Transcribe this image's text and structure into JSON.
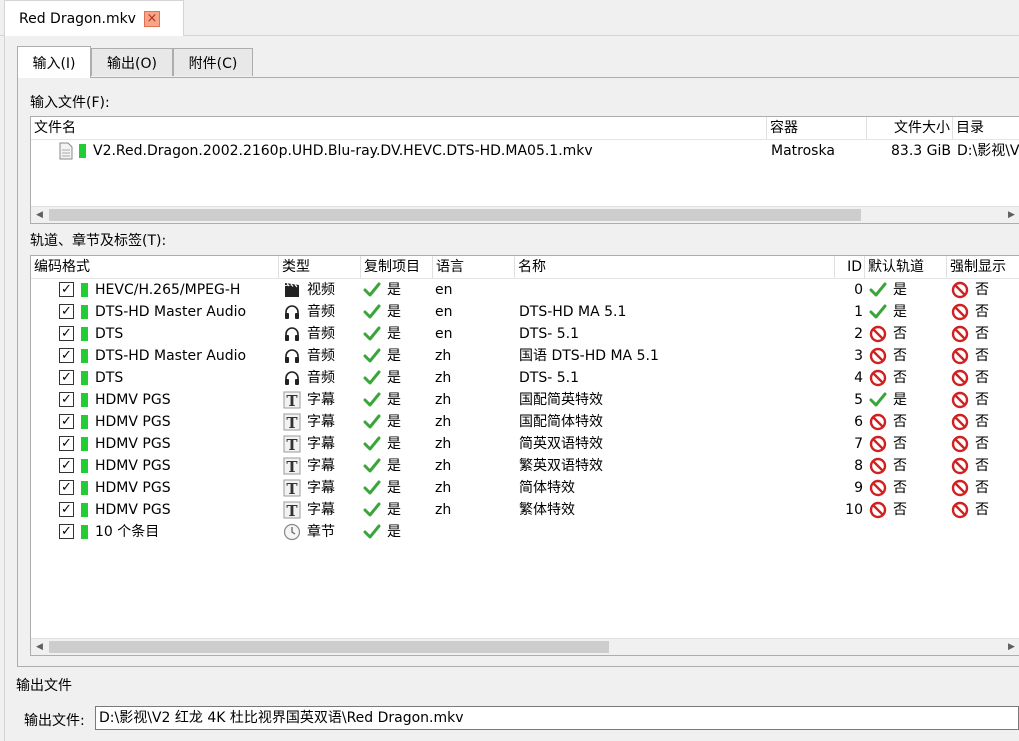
{
  "document_tab": {
    "label": "Red Dragon.mkv",
    "close_glyph": "×"
  },
  "subtabs": [
    {
      "label": "输入(I)"
    },
    {
      "label": "输出(O)"
    },
    {
      "label": "附件(C)"
    }
  ],
  "input_files": {
    "label": "输入文件(F):",
    "columns": [
      "文件名",
      "容器",
      "文件大小",
      "目录"
    ],
    "rows": [
      {
        "name": "V2.Red.Dragon.2002.2160p.UHD.Blu-ray.DV.HEVC.DTS-HD.MA05.1.mkv",
        "container": "Matroska",
        "size": "83.3 GiB",
        "dir": "D:\\影视\\V"
      }
    ]
  },
  "tracks": {
    "label": "轨道、章节及标签(T):",
    "columns": [
      "编码格式",
      "类型",
      "复制项目",
      "语言",
      "名称",
      "ID",
      "默认轨道",
      "强制显示"
    ],
    "rows": [
      {
        "codec": "HEVC/H.265/MPEG-H",
        "icon": "video-icon",
        "type": "视频",
        "copy": "是",
        "lang": "en",
        "name": "",
        "id": "0",
        "default_yes": true,
        "default": "是",
        "forced": "否"
      },
      {
        "codec": "DTS-HD Master Audio",
        "icon": "headphones-icon",
        "type": "音频",
        "copy": "是",
        "lang": "en",
        "name": "DTS-HD MA 5.1",
        "id": "1",
        "default_yes": true,
        "default": "是",
        "forced": "否"
      },
      {
        "codec": "DTS",
        "icon": "headphones-icon",
        "type": "音频",
        "copy": "是",
        "lang": "en",
        "name": "DTS- 5.1",
        "id": "2",
        "default_yes": false,
        "default": "否",
        "forced": "否"
      },
      {
        "codec": "DTS-HD Master Audio",
        "icon": "headphones-icon",
        "type": "音频",
        "copy": "是",
        "lang": "zh",
        "name": "国语 DTS-HD MA 5.1",
        "id": "3",
        "default_yes": false,
        "default": "否",
        "forced": "否"
      },
      {
        "codec": "DTS",
        "icon": "headphones-icon",
        "type": "音频",
        "copy": "是",
        "lang": "zh",
        "name": "DTS- 5.1",
        "id": "4",
        "default_yes": false,
        "default": "否",
        "forced": "否"
      },
      {
        "codec": "HDMV PGS",
        "icon": "subtitle-icon",
        "type": "字幕",
        "copy": "是",
        "lang": "zh",
        "name": "国配简英特效",
        "id": "5",
        "default_yes": true,
        "default": "是",
        "forced": "否"
      },
      {
        "codec": "HDMV PGS",
        "icon": "subtitle-icon",
        "type": "字幕",
        "copy": "是",
        "lang": "zh",
        "name": "国配简体特效",
        "id": "6",
        "default_yes": false,
        "default": "否",
        "forced": "否"
      },
      {
        "codec": "HDMV PGS",
        "icon": "subtitle-icon",
        "type": "字幕",
        "copy": "是",
        "lang": "zh",
        "name": "简英双语特效",
        "id": "7",
        "default_yes": false,
        "default": "否",
        "forced": "否"
      },
      {
        "codec": "HDMV PGS",
        "icon": "subtitle-icon",
        "type": "字幕",
        "copy": "是",
        "lang": "zh",
        "name": "繁英双语特效",
        "id": "8",
        "default_yes": false,
        "default": "否",
        "forced": "否"
      },
      {
        "codec": "HDMV PGS",
        "icon": "subtitle-icon",
        "type": "字幕",
        "copy": "是",
        "lang": "zh",
        "name": "简体特效",
        "id": "9",
        "default_yes": false,
        "default": "否",
        "forced": "否"
      },
      {
        "codec": "HDMV PGS",
        "icon": "subtitle-icon",
        "type": "字幕",
        "copy": "是",
        "lang": "zh",
        "name": "繁体特效",
        "id": "10",
        "default_yes": false,
        "default": "否",
        "forced": "否"
      },
      {
        "codec": "10 个条目",
        "icon": "chapter-icon",
        "type": "章节",
        "copy": "是",
        "lang": "",
        "name": "",
        "id": "",
        "default_yes": null,
        "default": "",
        "forced": ""
      }
    ]
  },
  "output": {
    "section_label": "输出文件",
    "field_label": "输出文件:",
    "path": "D:\\影视\\V2 红龙 4K 杜比视界国英双语\\Red Dragon.mkv"
  },
  "colors": {
    "check_green": "#3aa63a",
    "no_red": "#d02020",
    "track_green": "#22cc33"
  }
}
